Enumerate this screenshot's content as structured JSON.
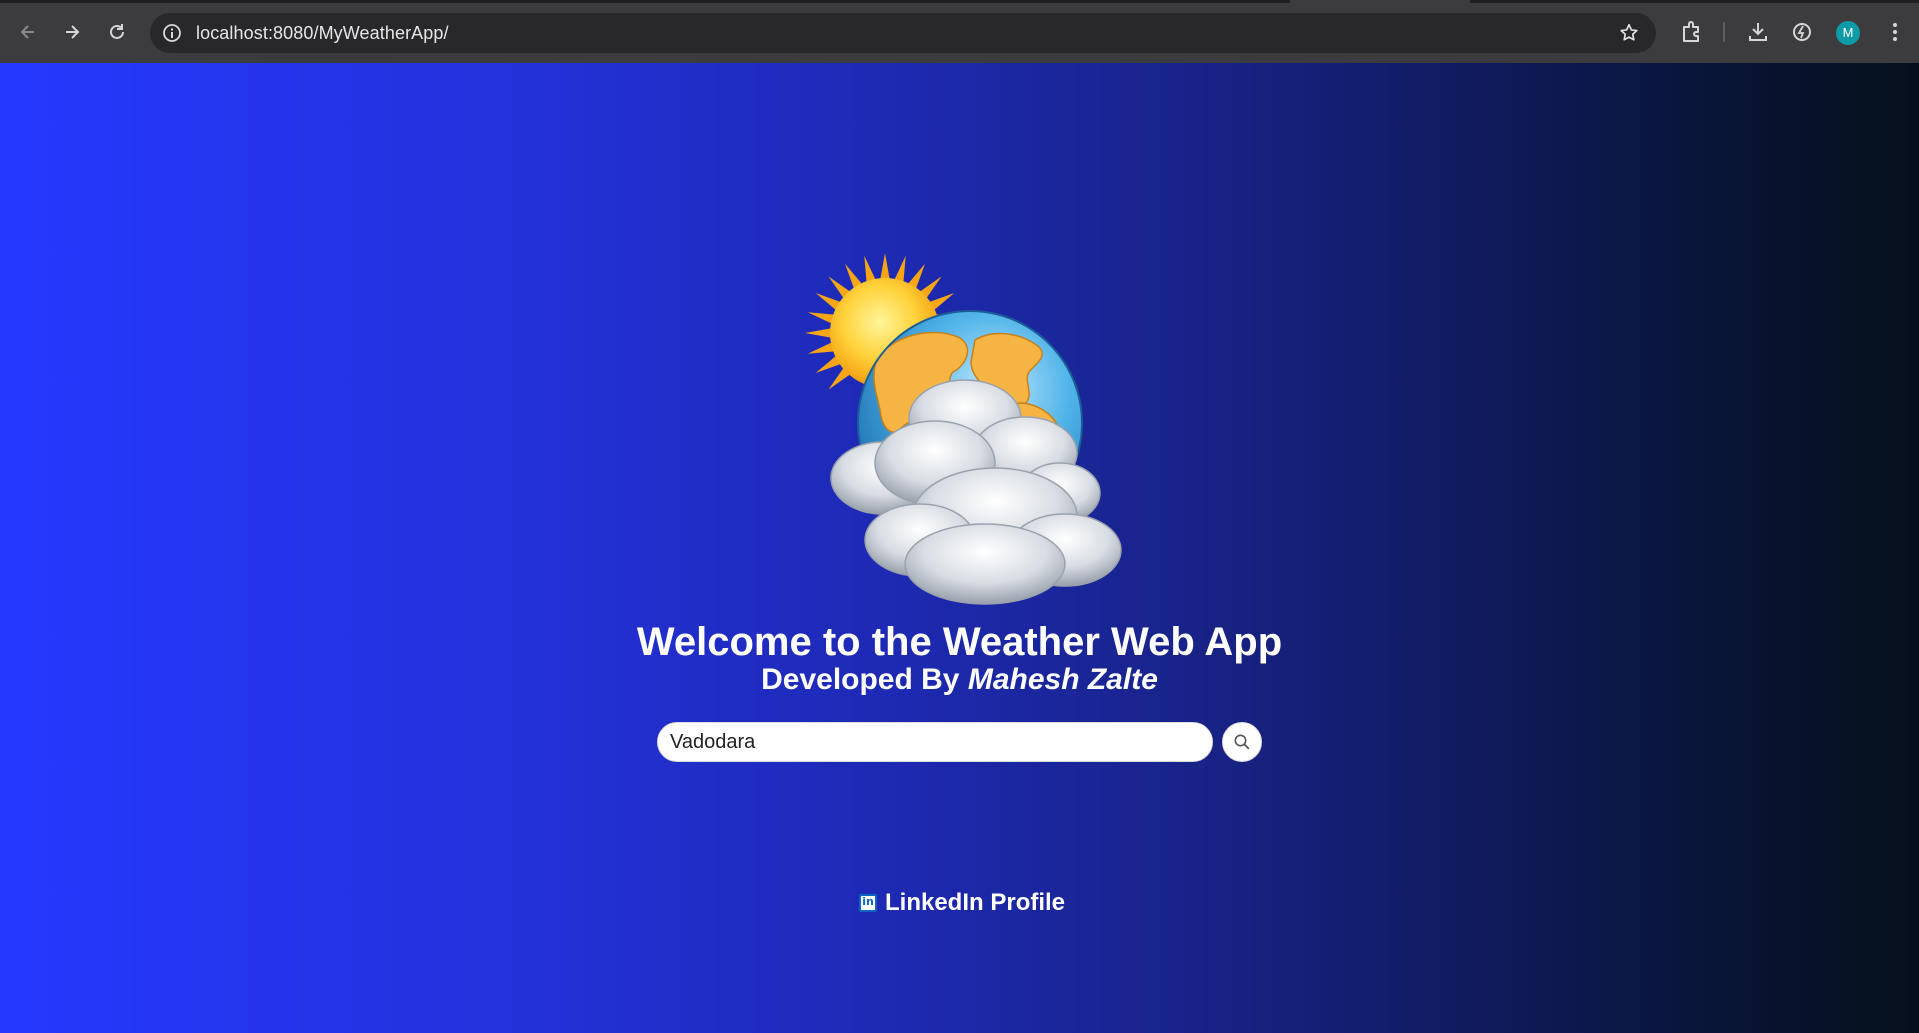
{
  "browser": {
    "url": "localhost:8080/MyWeatherApp/",
    "profile_initial": "M",
    "icons": [
      "back-icon",
      "forward-icon",
      "reload-icon",
      "site-info-icon",
      "bookmark-star-icon",
      "extensions-icon",
      "download-icon",
      "performance-icon",
      "menu-icon"
    ]
  },
  "page": {
    "title": "Welcome to the Weather Web App",
    "subtitle_prefix": "Developed By ",
    "author": "Mahesh Zalte",
    "search": {
      "value": "Vadodara"
    },
    "linkedin": {
      "icon_text": "in",
      "label": "LinkedIn Profile"
    }
  },
  "colors": {
    "gradient_start": "#2538ff",
    "gradient_end": "#06101c",
    "text": "#ffffff"
  }
}
